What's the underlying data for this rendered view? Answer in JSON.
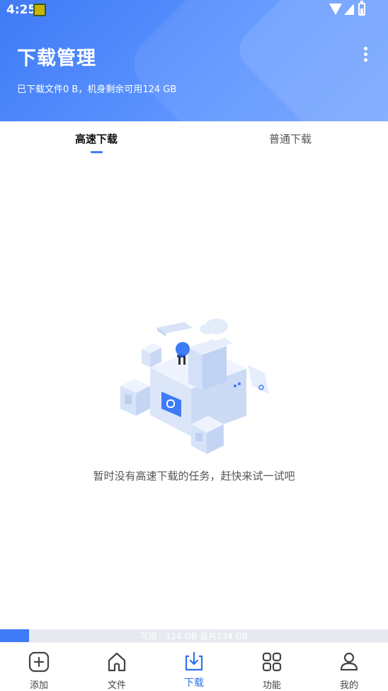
{
  "status_bar": {
    "time": "4:25"
  },
  "header": {
    "title": "下载管理",
    "storage_summary": "已下载文件0 B，机身剩余可用124 GB"
  },
  "tabs": [
    {
      "label": "高速下载",
      "active": true
    },
    {
      "label": "普通下载",
      "active": false
    }
  ],
  "empty_state": {
    "message": "暂时没有高速下载的任务，赶快来试一试吧"
  },
  "storage_bar": {
    "label": "可用：124 GB 总共134 GB",
    "used_fraction": 0.075
  },
  "bottom_nav": [
    {
      "label": "添加",
      "icon": "add-icon",
      "active": false
    },
    {
      "label": "文件",
      "icon": "home-icon",
      "active": false
    },
    {
      "label": "下载",
      "icon": "download-icon",
      "active": true
    },
    {
      "label": "功能",
      "icon": "grid-icon",
      "active": false
    },
    {
      "label": "我的",
      "icon": "user-icon",
      "active": false
    }
  ],
  "colors": {
    "accent": "#3f7bf6",
    "header_gradient_start": "#3f7bf6",
    "header_gradient_end": "#6ea2ff"
  }
}
